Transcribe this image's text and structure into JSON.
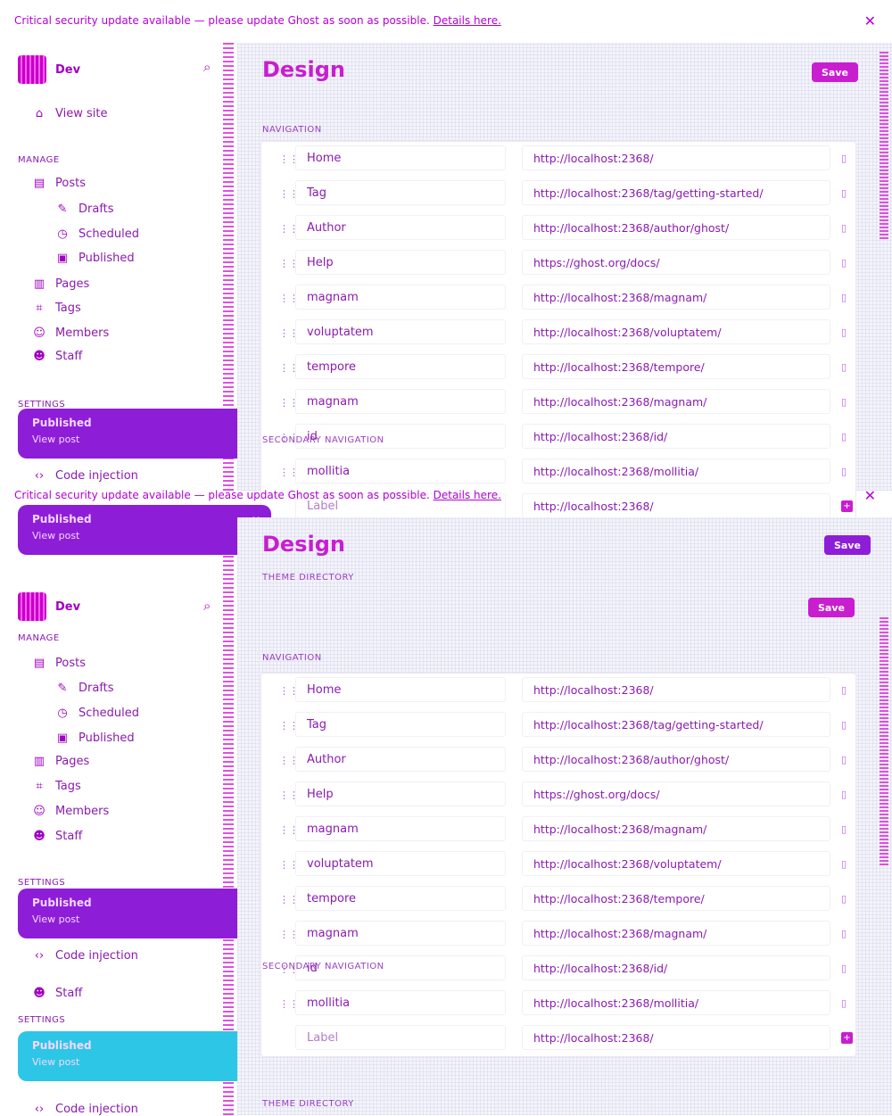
{
  "alert": {
    "message": "Critical security update available — please update Ghost as soon as possible.",
    "link": "Details here."
  },
  "brand": {
    "name": "Dev"
  },
  "sidebar": {
    "view_site": "View site",
    "manage_heading": "MANAGE",
    "posts": "Posts",
    "drafts": "Drafts",
    "scheduled": "Scheduled",
    "published": "Published",
    "pages": "Pages",
    "tags": "Tags",
    "members": "Members",
    "staff": "Staff",
    "settings_heading": "SETTINGS",
    "code_injection": "Code injection"
  },
  "toast": {
    "title": "Published",
    "subtitle": "View post"
  },
  "main": {
    "title": "Design",
    "save_label": "Save",
    "navigation_label": "NAVIGATION",
    "secondary_navigation_label": "SECONDARY NAVIGATION",
    "theme_directory_label": "THEME DIRECTORY",
    "new_label_placeholder": "Label",
    "new_url_placeholder": "http://localhost:2368/",
    "nav_items": [
      {
        "label": "Home",
        "url": "http://localhost:2368/"
      },
      {
        "label": "Tag",
        "url": "http://localhost:2368/tag/getting-started/"
      },
      {
        "label": "Author",
        "url": "http://localhost:2368/author/ghost/"
      },
      {
        "label": "Help",
        "url": "https://ghost.org/docs/"
      },
      {
        "label": "magnam",
        "url": "http://localhost:2368/magnam/"
      },
      {
        "label": "voluptatem",
        "url": "http://localhost:2368/voluptatem/"
      },
      {
        "label": "tempore",
        "url": "http://localhost:2368/tempore/"
      },
      {
        "label": "magnam",
        "url": "http://localhost:2368/magnam/"
      },
      {
        "label": "id",
        "url": "http://localhost:2368/id/"
      },
      {
        "label": "mollitia",
        "url": "http://localhost:2368/mollitia/"
      }
    ]
  },
  "colors": {
    "accent": "#c81ed0",
    "accent_purple": "#8e1dd8",
    "toast_cyan": "#2ec6e6",
    "text": "#8b1ab0"
  }
}
